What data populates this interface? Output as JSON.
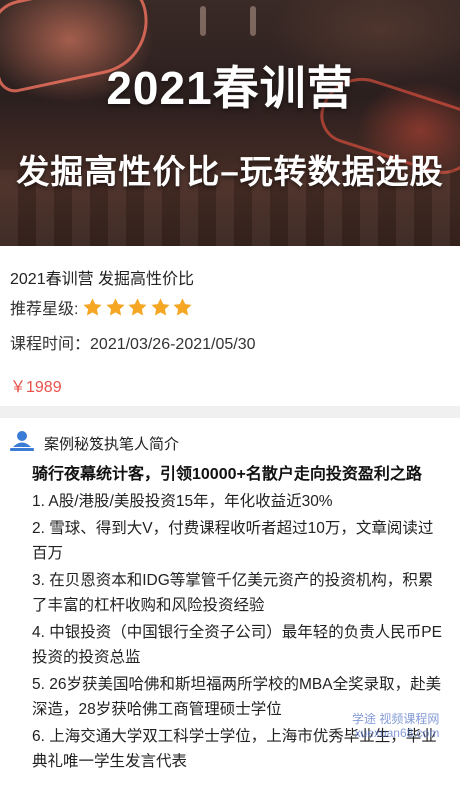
{
  "banner": {
    "title": "2021春训营",
    "subtitle": "发掘高性价比–玩转数据选股"
  },
  "course": {
    "title": "2021春训营 发掘高性价比",
    "rating_label": "推荐星级:",
    "rating_stars": 5,
    "rating_max": 5,
    "time_label": "课程时间：",
    "time_value": "2021/03/26-2021/05/30",
    "price": "￥1989"
  },
  "author": {
    "section_label": "案例秘笈执笔人简介",
    "icon": "person-icon",
    "headline": "骑行夜幕统计客，引领10000+名散户走向投资盈利之路",
    "points": [
      "1. A股/港股/美股投资15年，年化收益近30%",
      "2. 雪球、得到大V，付费课程收听者超过10万，文章阅读过百万",
      "3. 在贝恩资本和IDG等掌管千亿美元资产的投资机构，积累了丰富的杠杆收购和风险投资经验",
      "4. 中银投资（中国银行全资子公司）最年轻的负责人民币PE投资的投资总监",
      "5. 26岁获美国哈佛和斯坦福两所学校的MBA全奖录取，赴美深造，28岁获哈佛工商管理硕士学位",
      "6. 上海交通大学双工科学士学位，上海市优秀毕业生，毕业典礼唯一学生发言代表"
    ]
  },
  "watermark": {
    "line1": "学途 视频课程网",
    "line2": "xuexuan68.com"
  },
  "colors": {
    "price": "#e8514a",
    "star": "#f5a623",
    "icon": "#3a7bd5",
    "divider": "#f0f0f0"
  }
}
